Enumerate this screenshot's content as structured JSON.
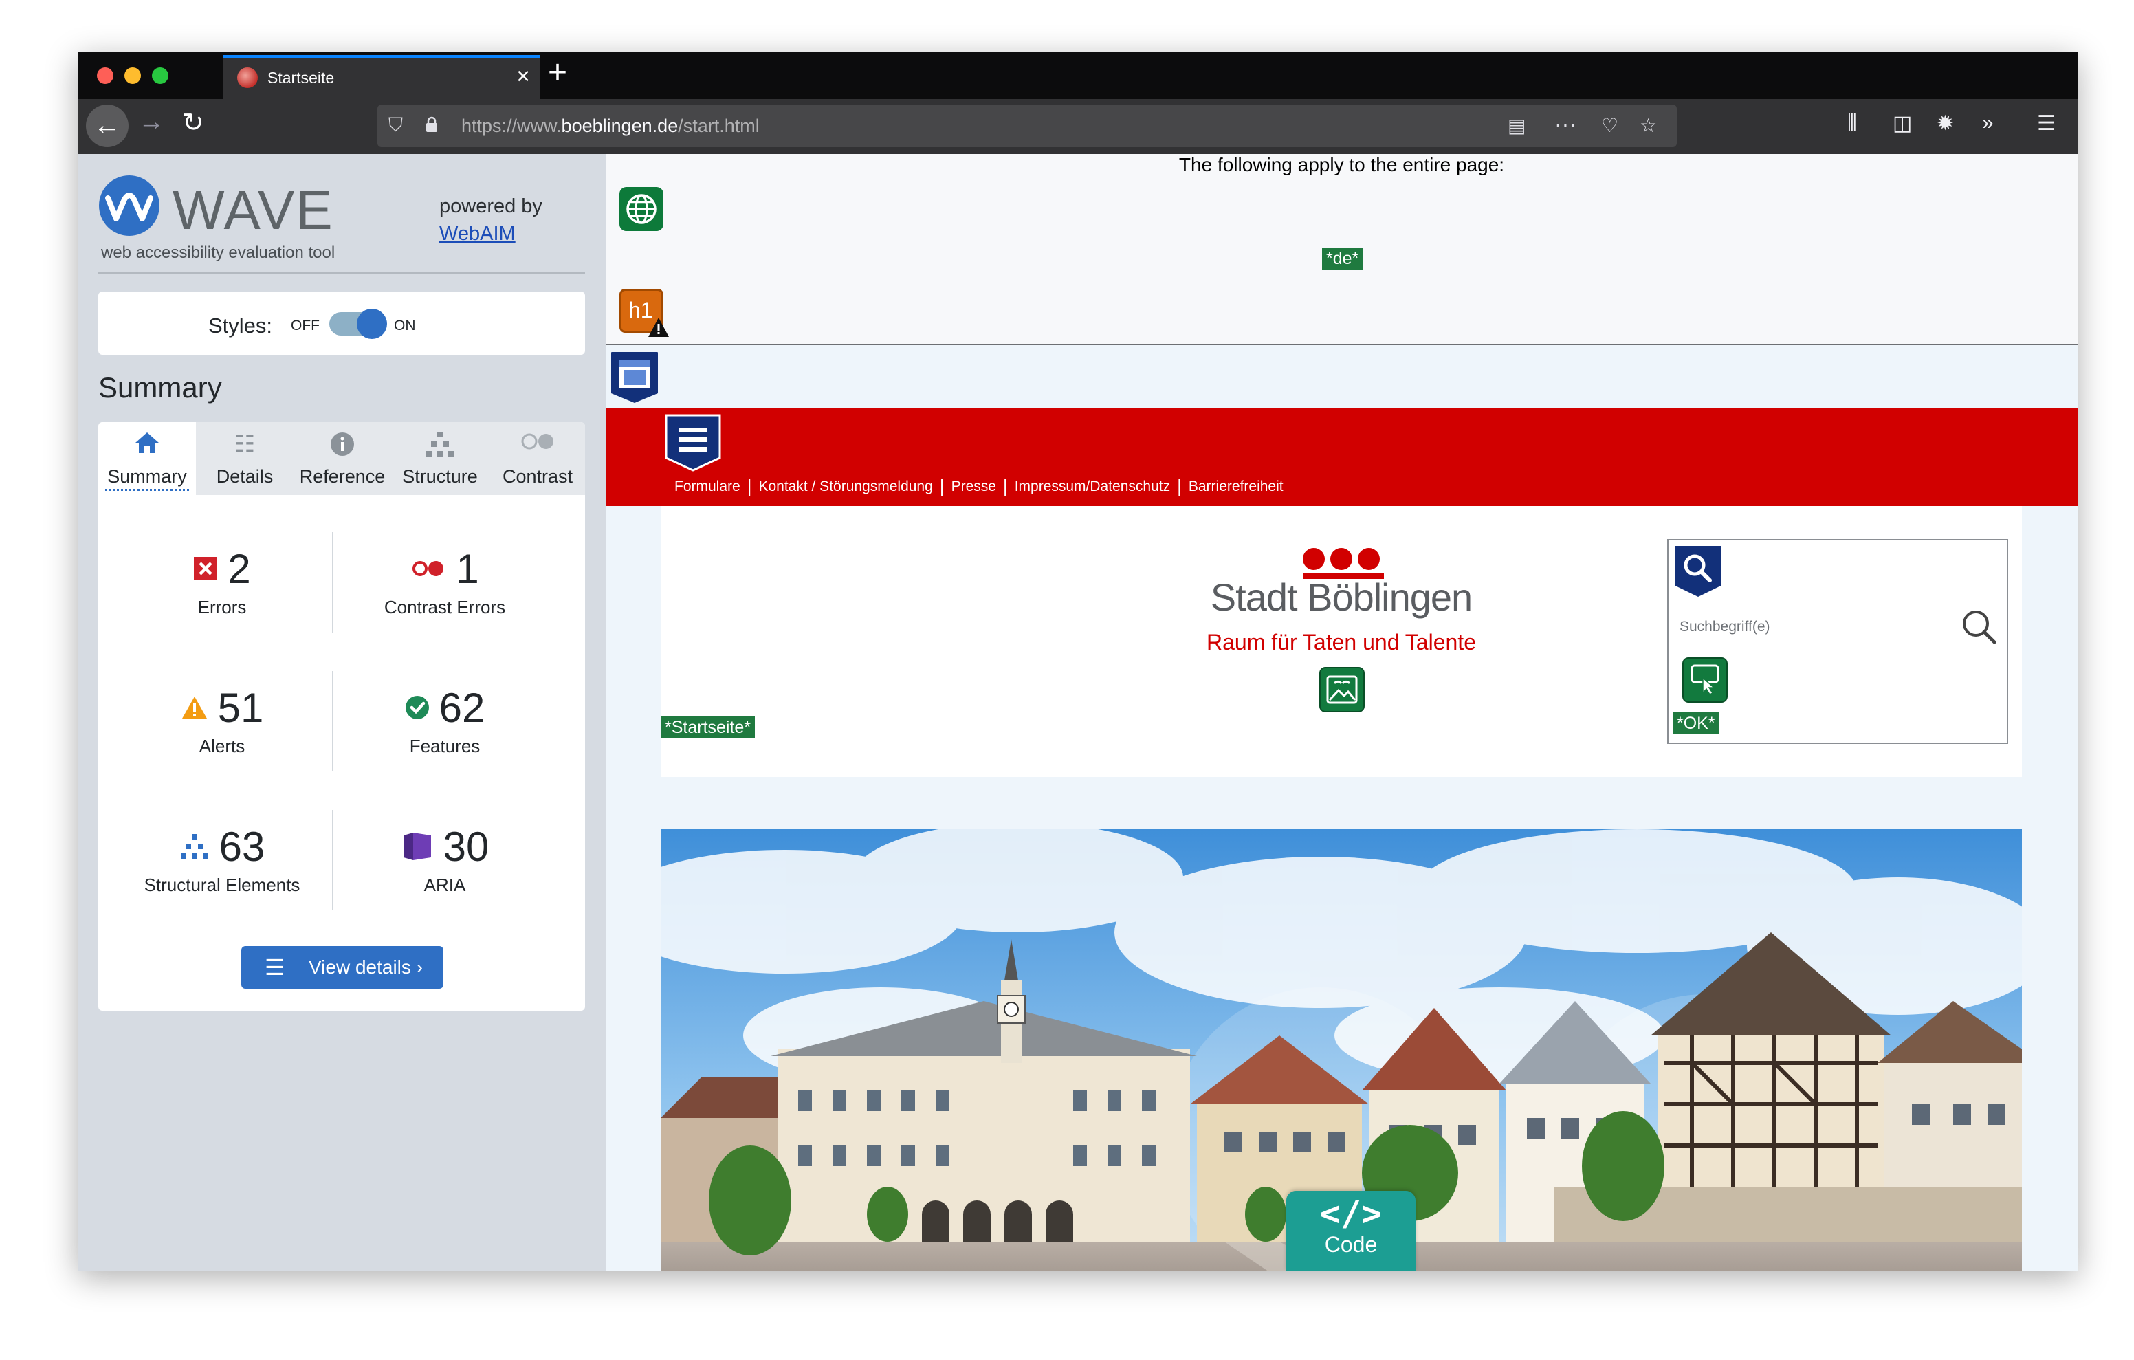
{
  "browser": {
    "tab_title": "Startseite",
    "url_prefix": "https://www.",
    "url_domain": "boeblingen.de",
    "url_path": "/start.html"
  },
  "wave": {
    "title": "WAVE",
    "subtitle": "web accessibility evaluation tool",
    "powered_by": "powered by",
    "webaim": "WebAIM",
    "styles_label": "Styles:",
    "styles_off": "OFF",
    "styles_on": "ON",
    "styles_enabled": true,
    "summary_heading": "Summary",
    "tabs": [
      {
        "label": "Summary",
        "icon": "home-icon",
        "active": true
      },
      {
        "label": "Details",
        "icon": "list-icon",
        "active": false
      },
      {
        "label": "Reference",
        "icon": "info-icon",
        "active": false
      },
      {
        "label": "Structure",
        "icon": "hierarchy-icon",
        "active": false
      },
      {
        "label": "Contrast",
        "icon": "contrast-icon",
        "active": false
      }
    ],
    "stats": {
      "errors": {
        "value": "2",
        "label": "Errors"
      },
      "contrast_errors": {
        "value": "1",
        "label": "Contrast Errors"
      },
      "alerts": {
        "value": "51",
        "label": "Alerts"
      },
      "features": {
        "value": "62",
        "label": "Features"
      },
      "structural": {
        "value": "63",
        "label": "Structural Elements"
      },
      "aria": {
        "value": "30",
        "label": "ARIA"
      }
    },
    "view_details": "View details ›"
  },
  "page": {
    "doc_note": "The following apply to the entire page:",
    "lang_tag": "*de*",
    "h1_label": "h1",
    "nav_links": [
      "Formulare",
      "Kontakt / Störungsmeldung",
      "Presse",
      "Impressum/Datenschutz",
      "Barrierefreiheit"
    ],
    "city_name": "Stadt Böblingen",
    "slogan": "Raum für Taten und Talente",
    "startseite_tag": "*Startseite*",
    "search_placeholder": "Suchbegriff(e)",
    "ok_tag": "*OK*",
    "code_label": "Code"
  },
  "colors": {
    "wave_blue": "#2f6fc4",
    "site_red": "#d10000",
    "wave_green": "#1f7a3f",
    "code_teal": "#1c9e93"
  }
}
